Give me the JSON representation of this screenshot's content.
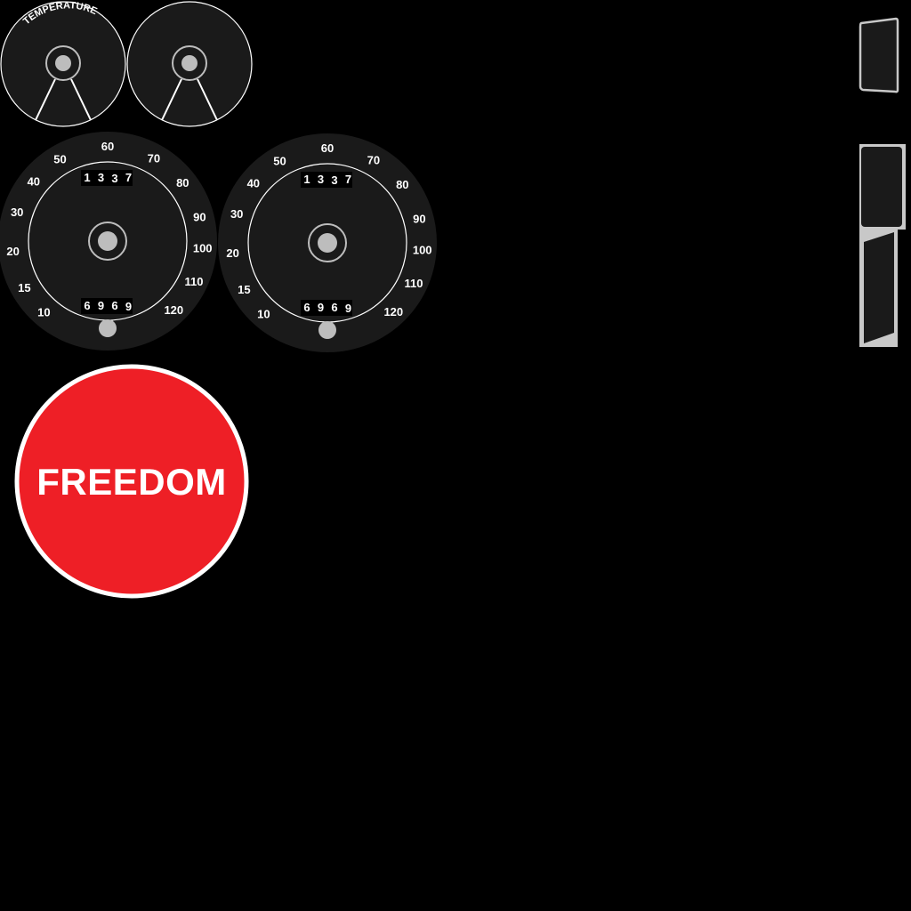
{
  "temperature_gauge": {
    "label": "TEMPERATURE"
  },
  "speedometer": {
    "scale": [
      "10",
      "15",
      "20",
      "30",
      "40",
      "50",
      "60",
      "70",
      "80",
      "90",
      "100",
      "110",
      "120"
    ],
    "trip_odometer": [
      "1",
      "3",
      "3",
      "7"
    ],
    "odometer": [
      "6",
      "9",
      "6",
      "9"
    ]
  },
  "badge": {
    "label": "FREEDOM"
  },
  "colors": {
    "background": "#000000",
    "dial": "#1a1a1a",
    "hub": "#bdbdbd",
    "line": "#ffffff",
    "badge_red": "#ee1f26",
    "panel": "#1a1a1a",
    "panel_border": "#c8c8c8"
  }
}
